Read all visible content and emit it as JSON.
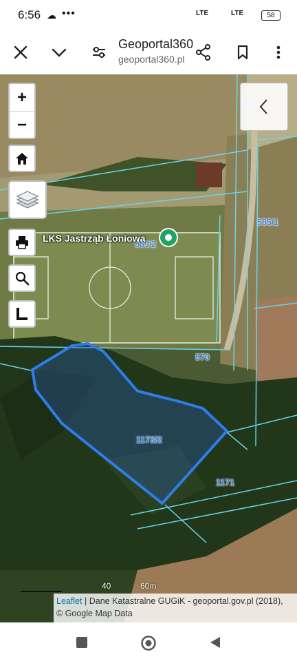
{
  "status_bar": {
    "time": "6:56",
    "dots": "•••",
    "signal1": "LTE",
    "signal2": "LTE",
    "battery": "58"
  },
  "toolbar": {
    "title": "Geoportal360.pl",
    "url": "geoportal360.pl"
  },
  "map": {
    "zoom_in_label": "+",
    "zoom_out_label": "−",
    "place_label": "LKS Jastrząb Łoniowa",
    "parcels": {
      "p584": "584",
      "p5851": "585/1",
      "p5692": "569/2",
      "p570": "570",
      "p11732": "1173/2",
      "p1171": "1171"
    },
    "scale": {
      "small": "40",
      "large": "60m"
    },
    "attribution": {
      "leaflet": "Leaflet",
      "rest": " | Dane Katastralne GUGiK - geoportal.gov.pl (2018),",
      "line2": "© Google Map Data"
    }
  },
  "colors": {
    "selected_parcel": "#2f7de8",
    "parcel_lines": "#66d6ec",
    "marker": "#1fa463"
  }
}
